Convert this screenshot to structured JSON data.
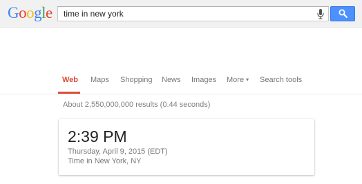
{
  "header": {
    "logo": {
      "letters": [
        "G",
        "o",
        "o",
        "g",
        "l",
        "e"
      ],
      "colors": [
        "#4285f4",
        "#ea4335",
        "#fbbc05",
        "#4285f4",
        "#34a853",
        "#ea4335"
      ]
    },
    "search": {
      "value": "time in new york",
      "mic_icon": "microphone-icon",
      "button_icon": "search-icon",
      "button_color": "#4d90fe"
    }
  },
  "tabs": [
    {
      "label": "Web",
      "active": true
    },
    {
      "label": "Maps",
      "active": false
    },
    {
      "label": "Shopping",
      "active": false
    },
    {
      "label": "News",
      "active": false
    },
    {
      "label": "Images",
      "active": false
    },
    {
      "label": "More",
      "active": false,
      "has_dropdown": true
    },
    {
      "label": "Search tools",
      "active": false
    }
  ],
  "results": {
    "stats": "About 2,550,000,000 results (0.44 seconds)"
  },
  "time_card": {
    "time": "2:39 PM",
    "date": "Thursday, April 9, 2015 (EDT)",
    "location": "Time in New York, NY"
  },
  "colors": {
    "active_tab": "#dd4b39",
    "header_bg": "#f1f1f1"
  }
}
